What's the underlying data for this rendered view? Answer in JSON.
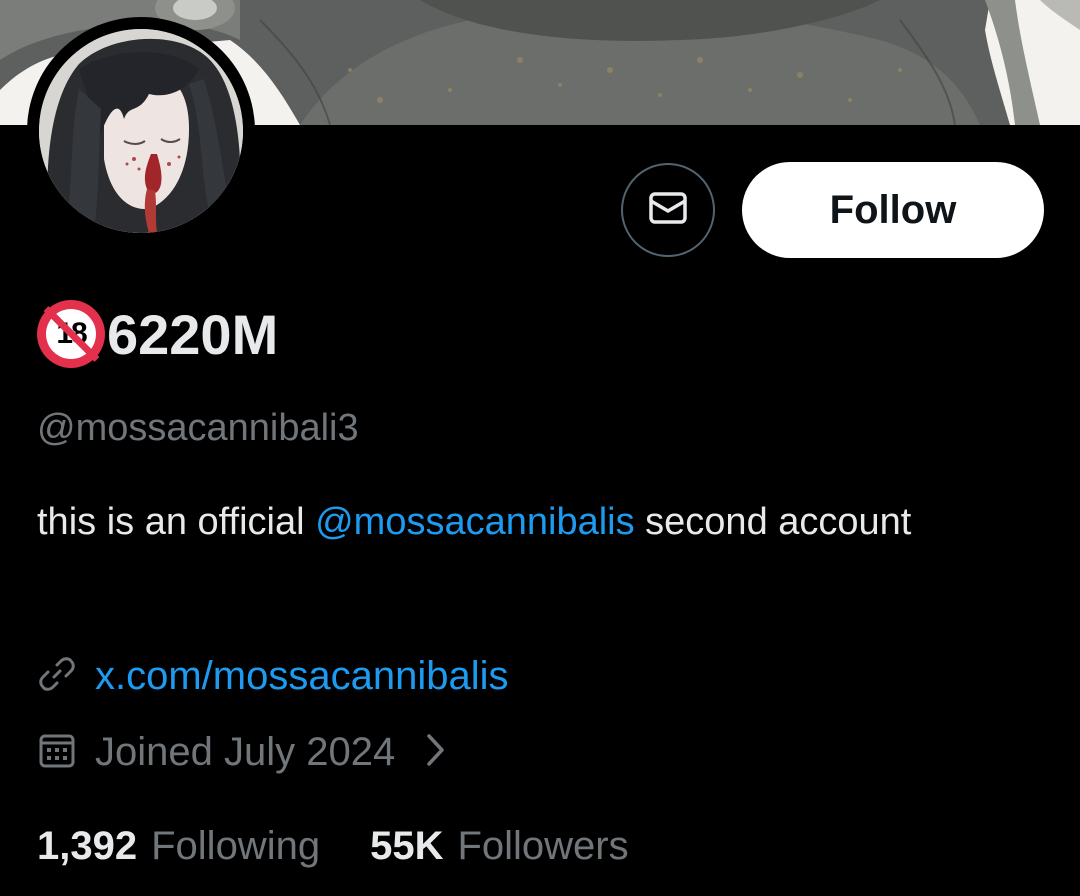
{
  "profile": {
    "display_name": "6220M",
    "badge_text": "18",
    "handle": "@mossacannibali3",
    "bio": {
      "prefix": "this is an official ",
      "mention": "@mossacannibalis",
      "suffix": " second account"
    },
    "website": "x.com/mossacannibalis",
    "joined": "Joined July 2024",
    "following_count": "1,392",
    "following_label": "Following",
    "followers_count": "55K",
    "followers_label": "Followers"
  },
  "actions": {
    "follow_label": "Follow"
  },
  "icons": {
    "message": "envelope-icon",
    "link": "link-icon",
    "calendar": "calendar-icon",
    "chevron": "chevron-right-icon"
  },
  "colors": {
    "background": "#000000",
    "accent": "#1d9bf0",
    "secondary_text": "#71767b",
    "badge_red": "#e3304c"
  }
}
